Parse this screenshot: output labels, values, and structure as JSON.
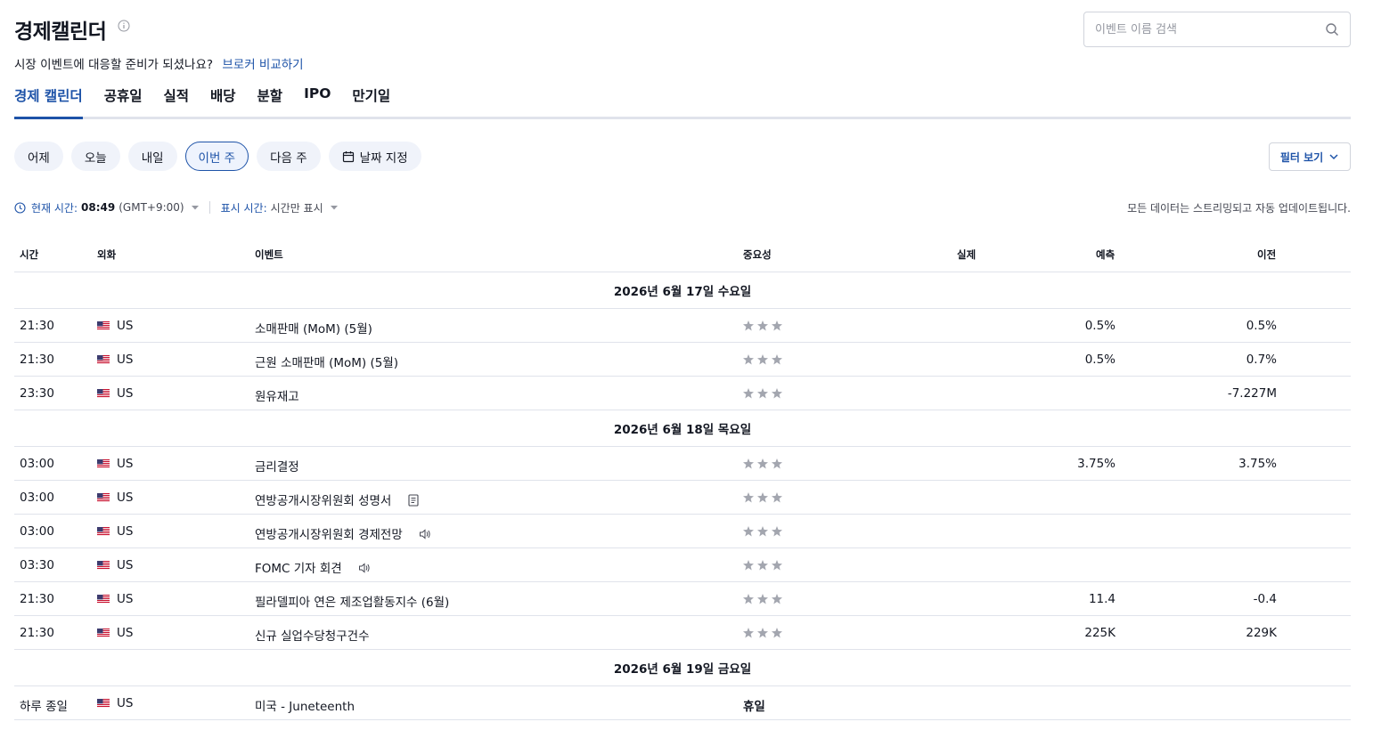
{
  "header": {
    "title": "경제캘린더",
    "subtitle": "시장 이벤트에 대응할 준비가 되셨나요?",
    "subtitle_link": "브로커 비교하기",
    "search_placeholder": "이벤트 이름 검색"
  },
  "tabs": [
    {
      "label": "경제 캘린더",
      "active": true
    },
    {
      "label": "공휴일"
    },
    {
      "label": "실적"
    },
    {
      "label": "배당"
    },
    {
      "label": "분할"
    },
    {
      "label": "IPO"
    },
    {
      "label": "만기일"
    }
  ],
  "range_buttons": [
    {
      "label": "어제"
    },
    {
      "label": "오늘"
    },
    {
      "label": "내일"
    },
    {
      "label": "이번 주",
      "active": true
    },
    {
      "label": "다음 주"
    },
    {
      "label": "날짜 지정"
    }
  ],
  "filter_label": "필터 보기",
  "time_bar": {
    "current_label": "현재 시간:",
    "current_time": "08:49",
    "timezone": "(GMT+9:00)",
    "display_label": "표시 시간:",
    "display_value": "시간만 표시",
    "streaming_note": "모든 데이터는 스트리밍되고 자동 업데이트됩니다."
  },
  "table": {
    "columns": {
      "time": "시간",
      "currency": "외화",
      "event": "이벤트",
      "importance": "중요성",
      "actual": "실제",
      "forecast": "예측",
      "previous": "이전"
    },
    "groups": [
      {
        "date": "2026년 6월 17일 수요일",
        "rows": [
          {
            "time": "21:30",
            "currency": "US",
            "event": "소매판매 (MoM) (5월)",
            "actual": "",
            "forecast": "0.5%",
            "previous": "0.5%"
          },
          {
            "time": "21:30",
            "currency": "US",
            "event": "근원 소매판매 (MoM) (5월)",
            "actual": "",
            "forecast": "0.5%",
            "previous": "0.7%"
          },
          {
            "time": "23:30",
            "currency": "US",
            "event": "원유재고",
            "actual": "",
            "forecast": "",
            "previous": "-7.227M"
          }
        ]
      },
      {
        "date": "2026년 6월 18일 목요일",
        "rows": [
          {
            "time": "03:00",
            "currency": "US",
            "event": "금리결정",
            "actual": "",
            "forecast": "3.75%",
            "previous": "3.75%"
          },
          {
            "time": "03:00",
            "currency": "US",
            "event": "연방공개시장위원회 성명서",
            "icon": "document-icon",
            "actual": "",
            "forecast": "",
            "previous": ""
          },
          {
            "time": "03:00",
            "currency": "US",
            "event": "연방공개시장위원회 경제전망",
            "icon": "speaker-icon",
            "actual": "",
            "forecast": "",
            "previous": ""
          },
          {
            "time": "03:30",
            "currency": "US",
            "event": "FOMC 기자 회견",
            "icon": "speaker-icon",
            "actual": "",
            "forecast": "",
            "previous": ""
          },
          {
            "time": "21:30",
            "currency": "US",
            "event": "필라델피아 연은 제조업활동지수  (6월)",
            "actual": "",
            "forecast": "11.4",
            "previous": "-0.4"
          },
          {
            "time": "21:30",
            "currency": "US",
            "event": "신규 실업수당청구건수",
            "actual": "",
            "forecast": "225K",
            "previous": "229K"
          }
        ]
      },
      {
        "date": "2026년 6월 19일 금요일",
        "rows": [
          {
            "time": "하루 종일",
            "currency": "US",
            "event": "미국 - Juneteenth",
            "holiday": "휴일",
            "actual": "",
            "forecast": "",
            "previous": ""
          }
        ]
      }
    ]
  },
  "colors": {
    "accent": "#1e53a8",
    "text": "#131722",
    "border": "#e0e3eb",
    "star": "#a3a6af"
  }
}
